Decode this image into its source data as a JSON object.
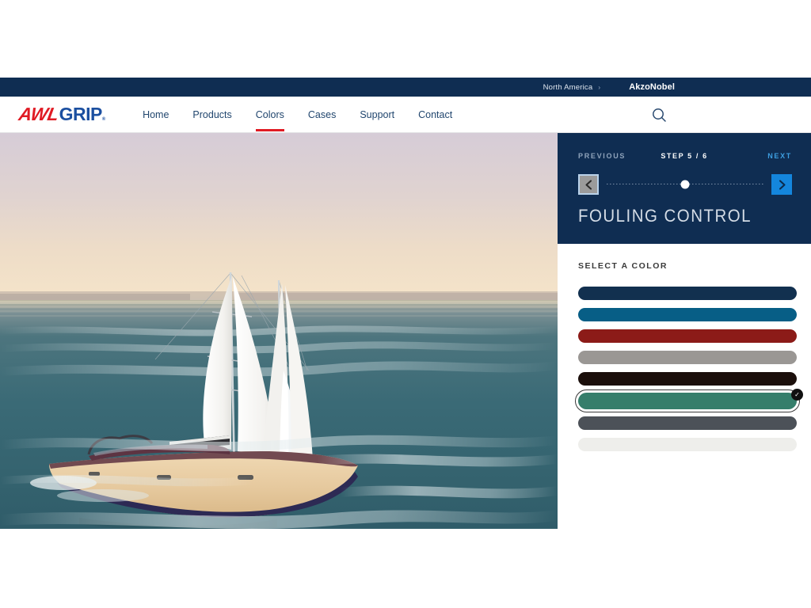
{
  "utility_bar": {
    "region_label": "North America",
    "region_chevron": "›",
    "brand": "AkzoNobel"
  },
  "header": {
    "logo": {
      "part1": "AWL",
      "part2": "GRIP",
      "registered": "®"
    },
    "nav": [
      {
        "label": "Home",
        "active": false
      },
      {
        "label": "Products",
        "active": false
      },
      {
        "label": "Colors",
        "active": true
      },
      {
        "label": "Cases",
        "active": false
      },
      {
        "label": "Support",
        "active": false
      },
      {
        "label": "Contact",
        "active": false
      }
    ],
    "search_icon": "search-icon"
  },
  "hero": {
    "scene": "sailboat-on-water-at-sunset",
    "sky_top_color": "#d6cdd6",
    "sky_horizon_color": "#f2e0c6",
    "water_color": "#3d6b75",
    "hull_color": "#e8cda2",
    "sail_color": "#f7f7f5"
  },
  "step_panel": {
    "previous_label": "PREVIOUS",
    "step_label": "STEP 5 / 6",
    "next_label": "NEXT",
    "current_step": 5,
    "total_steps": 6,
    "prev_icon": "chevron-left-icon",
    "next_icon": "chevron-right-icon",
    "title": "FOULING CONTROL",
    "panel_color": "#0f2d52",
    "next_button_color": "#1486dd",
    "prev_button_color": "#9b9b9b"
  },
  "color_picker": {
    "title": "SELECT A COLOR",
    "selected_index": 5,
    "check_glyph": "✓",
    "swatches": [
      {
        "name": "swatch-navy",
        "color": "#12304f"
      },
      {
        "name": "swatch-ocean-blue",
        "color": "#075e86"
      },
      {
        "name": "swatch-dark-red",
        "color": "#8c1b18"
      },
      {
        "name": "swatch-gray",
        "color": "#9a9794"
      },
      {
        "name": "swatch-near-black",
        "color": "#1b0f0b"
      },
      {
        "name": "swatch-teal-green",
        "color": "#357e6b"
      },
      {
        "name": "swatch-slate-gray",
        "color": "#4c5158"
      },
      {
        "name": "swatch-off-white",
        "color": "#eeeeeb"
      }
    ]
  }
}
